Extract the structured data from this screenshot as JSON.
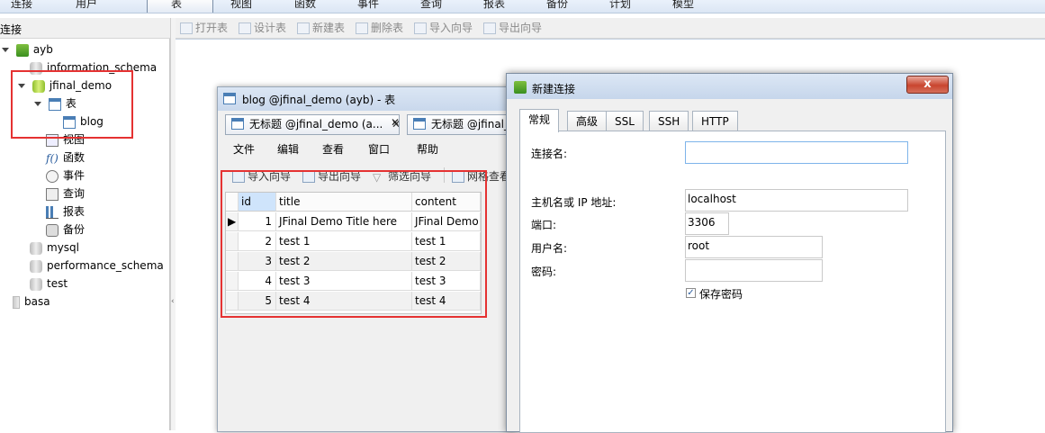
{
  "ribbon": {
    "items": [
      "连接",
      "用户",
      "表",
      "视图",
      "函数",
      "事件",
      "查询",
      "报表",
      "备份",
      "计划",
      "模型"
    ],
    "active": "表"
  },
  "left_panel": {
    "header": "连接",
    "tree": {
      "connection": "ayb",
      "databases": [
        "information_schema",
        "jfinal_demo",
        "mysql",
        "performance_schema",
        "test"
      ],
      "open_db": "jfinal_demo",
      "open_db_children": [
        "表",
        "视图",
        "函数",
        "事件",
        "查询",
        "报表",
        "备份"
      ],
      "table": "blog",
      "other_connection": "basa"
    }
  },
  "toolbar": {
    "buttons": [
      "打开表",
      "设计表",
      "新建表",
      "删除表",
      "导入向导",
      "导出向导"
    ]
  },
  "blog_window": {
    "title": "blog @jfinal_demo (ayb) - 表",
    "tabs": [
      "无标题 @jfinal_demo (a...",
      "无标题 @jfinal_"
    ],
    "menu": [
      "文件",
      "编辑",
      "查看",
      "窗口",
      "帮助"
    ],
    "toolbar": [
      "导入向导",
      "导出向导",
      "筛选向导",
      "网格查看"
    ],
    "grid": {
      "columns": [
        "id",
        "title",
        "content"
      ],
      "rows": [
        {
          "id": "1",
          "title": "JFinal Demo Title here",
          "content": "JFinal Demo"
        },
        {
          "id": "2",
          "title": "test 1",
          "content": "test 1"
        },
        {
          "id": "3",
          "title": "test 2",
          "content": "test 2"
        },
        {
          "id": "4",
          "title": "test 3",
          "content": "test 3"
        },
        {
          "id": "5",
          "title": "test 4",
          "content": "test 4"
        }
      ]
    }
  },
  "new_connection_dialog": {
    "title": "新建连接",
    "close": "x",
    "tabs": [
      "常规",
      "高级",
      "SSL",
      "SSH",
      "HTTP"
    ],
    "active_tab": "常规",
    "fields": {
      "conn_name_label": "连接名:",
      "conn_name_value": "",
      "host_label": "主机名或 IP 地址:",
      "host_value": "localhost",
      "port_label": "端口:",
      "port_value": "3306",
      "user_label": "用户名:",
      "user_value": "root",
      "password_label": "密码:",
      "password_value": "",
      "save_password_label": "保存密码",
      "save_password_checked": true
    }
  },
  "colors": {
    "highlight_red": "#e53232",
    "title_bar": "#c9d8ec",
    "id_header": "#cfe4fb"
  }
}
